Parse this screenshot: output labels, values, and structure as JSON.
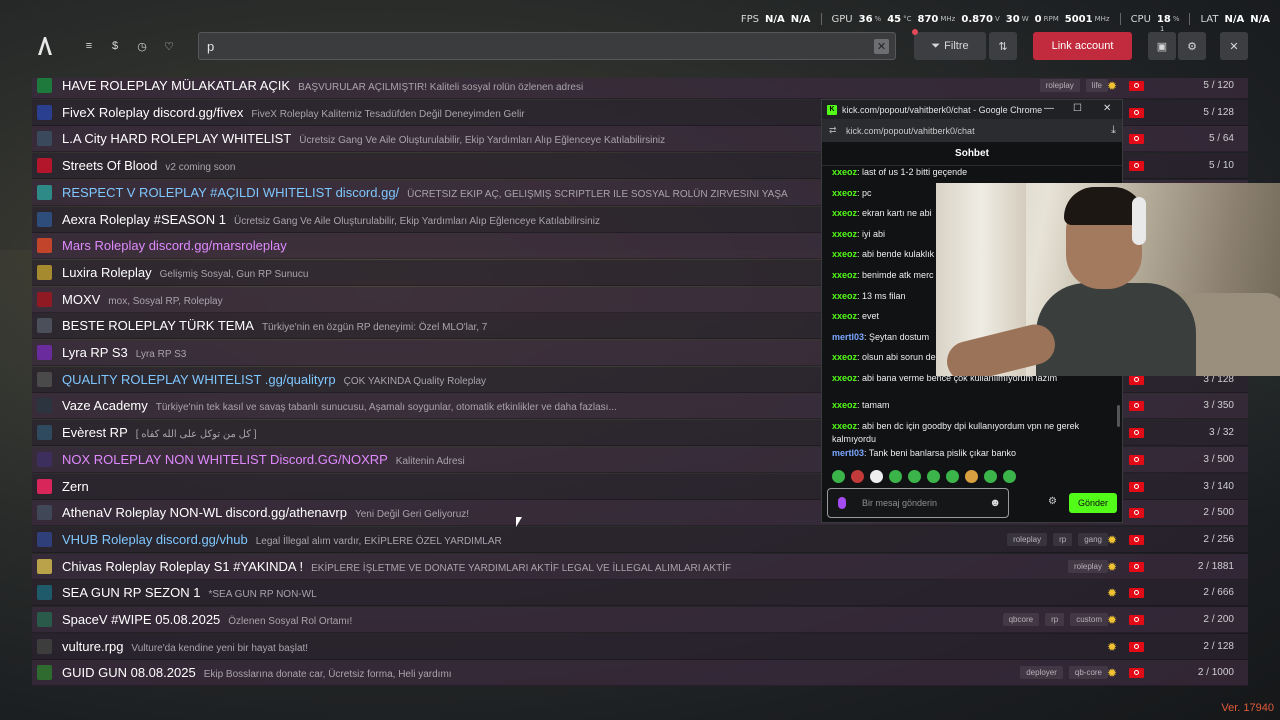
{
  "perf": {
    "fps_label": "FPS",
    "fps_value": "N/A",
    "fps_value2": "N/A",
    "gpu_label": "GPU",
    "gpu_load": "36",
    "gpu_temp": "45",
    "gpu_clock": "870",
    "gpu_volt": "0.870",
    "gpu_power": "30",
    "gpu_rpm": "0",
    "gpu_mem": "5001",
    "cpu_label": "CPU",
    "cpu_load": "18",
    "lat_label": "LAT",
    "lat_value": "N/A",
    "lat_value2": "N/A"
  },
  "header": {
    "search_value": "p",
    "filter_label": "Filtre",
    "link_account_label": "Link account",
    "badge_count": "1"
  },
  "servers": [
    {
      "name": "HAVE ROLEPLAY MÜLAKATLAR AÇIK",
      "desc": "BAŞVURULAR AÇILMIŞTIR! Kaliteli sosyal rolün özlenen adresi",
      "tags": [
        "roleplay",
        "life"
      ],
      "players": "5 / 120",
      "name_color": "#ffffff",
      "icon_bg": "#1e7a3c"
    },
    {
      "name": "FiveX Roleplay discord.gg/fivex",
      "desc": "FiveX Roleplay Kalitemiz Tesadüfden Değil Deneyimden Gelir",
      "tags": [],
      "players": "5 / 128",
      "name_color": "#ffffff",
      "icon_bg": "#2a3f8f"
    },
    {
      "name": "L.A City HARD ROLEPLAY WHITELIST",
      "desc": "Ücretsiz Gang Ve Aile Oluşturulabilir, Ekip Yardımları Alıp Eğlenceye Katılabilirsiniz",
      "tags": [],
      "players": "5 / 64",
      "name_color": "#ffffff",
      "icon_bg": "#3a4a5c"
    },
    {
      "name": "Streets Of Blood",
      "desc": "v2 coming soon",
      "tags": [],
      "players": "5 / 10",
      "name_color": "#ffffff",
      "icon_bg": "#b3152a"
    },
    {
      "name": "RESPECT V ROLEPLAY #AÇILDI WHITELIST discord.gg/",
      "desc": "ÜCRETSIZ EKIP AÇ, GELIŞMIŞ SCRIPTLER ILE SOSYAL ROLÜN ZIRVESINI YAŞA",
      "tags": [],
      "players": "",
      "name_color": "#7fc7ff",
      "icon_bg": "#2d8a86"
    },
    {
      "name": "Aexra Roleplay #SEASON 1",
      "desc": "Ücretsiz Gang Ve Aile Oluşturulabilir, Ekip Yardımları Alıp Eğlenceye Katılabilirsiniz",
      "tags": [],
      "players": "",
      "name_color": "#ffffff",
      "icon_bg": "#2e4d7a"
    },
    {
      "name": "Mars Roleplay discord.gg/marsroleplay",
      "desc": "",
      "tags": [],
      "players": "",
      "name_color": "#e08aff",
      "icon_bg": "#c2452b"
    },
    {
      "name": "Luxira Roleplay",
      "desc": "Gelişmiş Sosyal, Gun RP Sunucu",
      "tags": [],
      "players": "",
      "name_color": "#ffffff",
      "icon_bg": "#a58a2f"
    },
    {
      "name": "MOXV",
      "desc": "mox, Sosyal RP, Roleplay",
      "tags": [],
      "players": "",
      "name_color": "#ffffff",
      "icon_bg": "#8f1a24"
    },
    {
      "name": "BESTE ROLEPLAY TÜRK TEMA",
      "desc": "Türkiye'nin en özgün RP deneyimi: Özel MLO'lar, 7",
      "tags": [],
      "players": "",
      "name_color": "#ffffff",
      "icon_bg": "#4b4f5a"
    },
    {
      "name": "Lyra RP S3",
      "desc": "Lyra RP S3",
      "tags": [],
      "players": "",
      "name_color": "#ffffff",
      "icon_bg": "#6a2c9c"
    },
    {
      "name": "QUALITY ROLEPLAY WHITELIST .gg/qualityrp",
      "desc": "ÇOK YAKINDA Quality Roleplay",
      "tags": [],
      "players": "3 / 128",
      "name_color": "#7fc7ff",
      "icon_bg": "#4a4a4a"
    },
    {
      "name": "Vaze Academy",
      "desc": "Türkiye'nin tek kasıl ve savaş tabanlı sunucusu, Aşamalı soygunlar, otomatik etkinlikler ve daha fazlası...",
      "tags": [],
      "players": "3 / 350",
      "name_color": "#ffffff",
      "icon_bg": "#2c3440"
    },
    {
      "name": "Evèrest RP",
      "desc": "[ کل من توکل علی الله کفاه ]",
      "tags": [],
      "players": "3 / 32",
      "name_color": "#ffffff",
      "icon_bg": "#2f4a5e"
    },
    {
      "name": "NOX ROLEPLAY NON WHITELIST Discord.GG/NOXRP",
      "desc": "Kalitenin Adresi",
      "tags": [],
      "players": "3 / 500",
      "name_color": "#e08aff",
      "icon_bg": "#3c2f5e"
    },
    {
      "name": "Zern",
      "desc": "",
      "tags": [],
      "players": "3 / 140",
      "name_color": "#ffffff",
      "icon_bg": "#d8265b"
    },
    {
      "name": "AthenaV Roleplay NON-WL discord.gg/athenavrp",
      "desc": "Yeni Değil Geri Geliyoruz!",
      "tags": [],
      "players": "2 / 500",
      "name_color": "#ffffff",
      "icon_bg": "#404858"
    },
    {
      "name": "VHUB Roleplay discord.gg/vhub",
      "desc": "Legal İllegal alım vardır, EKİPLERE ÖZEL YARDIMLAR",
      "tags": [
        "roleplay",
        "rp",
        "gang"
      ],
      "players": "2 / 256",
      "name_color": "#7fc7ff",
      "icon_bg": "#2f3f7a"
    },
    {
      "name": "Chivas Roleplay Roleplay S1 #YAKINDA !",
      "desc": "EKİPLERE İŞLETME VE DONATE YARDIMLARI AKTİF LEGAL VE İLLEGAL ALIMLARI AKTİF",
      "tags": [
        "roleplay"
      ],
      "players": "2 / 1881",
      "name_color": "#ffffff",
      "icon_bg": "#b9a24a"
    },
    {
      "name": "SEA GUN RP SEZON 1",
      "desc": "*SEA GUN RP NON-WL",
      "tags": [],
      "players": "2 / 666",
      "name_color": "#ffffff",
      "icon_bg": "#1f5a6a"
    },
    {
      "name": "SpaceV #WIPE 05.08.2025",
      "desc": "Özlenen Sosyal Rol Ortamı!",
      "tags": [
        "qbcore",
        "rp",
        "custom"
      ],
      "players": "2 / 200",
      "name_color": "#ffffff",
      "icon_bg": "#2a5a4a"
    },
    {
      "name": "vulture.rpg",
      "desc": "Vulture'da kendine yeni bir hayat başlat!",
      "tags": [],
      "players": "2 / 128",
      "name_color": "#ffffff",
      "icon_bg": "#3d3d3d"
    },
    {
      "name": "GUID GUN 08.08.2025",
      "desc": "Ekip Bosslarına donate car, Ücretsiz forma, Heli yardımı",
      "tags": [
        "deployer",
        "qb-core"
      ],
      "players": "2 / 1000",
      "name_color": "#ffffff",
      "icon_bg": "#2f6a2f"
    }
  ],
  "popup": {
    "window_title": "kick.com/popout/vahitberk0/chat - Google Chrome",
    "url": "kick.com/popout/vahitberk0/chat",
    "chat_title": "Sohbet",
    "messages": [
      {
        "user": "xxeoz",
        "text": "last of us 1-2 bitti geçende",
        "color": "green"
      },
      {
        "user": "xxeoz",
        "text": "pc",
        "color": "green"
      },
      {
        "user": "xxeoz",
        "text": "ekran kartı ne abi",
        "color": "green"
      },
      {
        "user": "xxeoz",
        "text": "iyi abi",
        "color": "green"
      },
      {
        "user": "xxeoz",
        "text": "abi bende kulaklık",
        "color": "green"
      },
      {
        "user": "xxeoz",
        "text": "benimde atk merc",
        "color": "green"
      },
      {
        "user": "xxeoz",
        "text": "13 ms filan",
        "color": "green"
      },
      {
        "user": "xxeoz",
        "text": "evet",
        "color": "green"
      },
      {
        "user": "mertl03",
        "text": "Şeytan dostum",
        "color": "blue"
      },
      {
        "user": "xxeoz",
        "text": "olsun abi sorun de",
        "color": "green"
      },
      {
        "user": "xxeoz",
        "text": "abi bana verme bence çok kullanılmıyorum lazım",
        "color": "green"
      },
      {
        "user": "xxeoz",
        "text": "tamam",
        "color": "green"
      },
      {
        "user": "xxeoz",
        "text": "abi ben dc için goodby dpi kullanıyordum vpn ne gerek kalmıyordu",
        "color": "green"
      },
      {
        "user": "mertl03",
        "text": "Tank beni banlarsa pislik çıkar banko",
        "color": "blue"
      }
    ],
    "input_placeholder": "Bir mesaj gönderin",
    "send_label": "Gönder"
  },
  "version": "Ver. 17940",
  "colors": {
    "accent_red": "#c22a3d",
    "kick_green": "#53fc18",
    "version_orange": "#e05a3a"
  }
}
